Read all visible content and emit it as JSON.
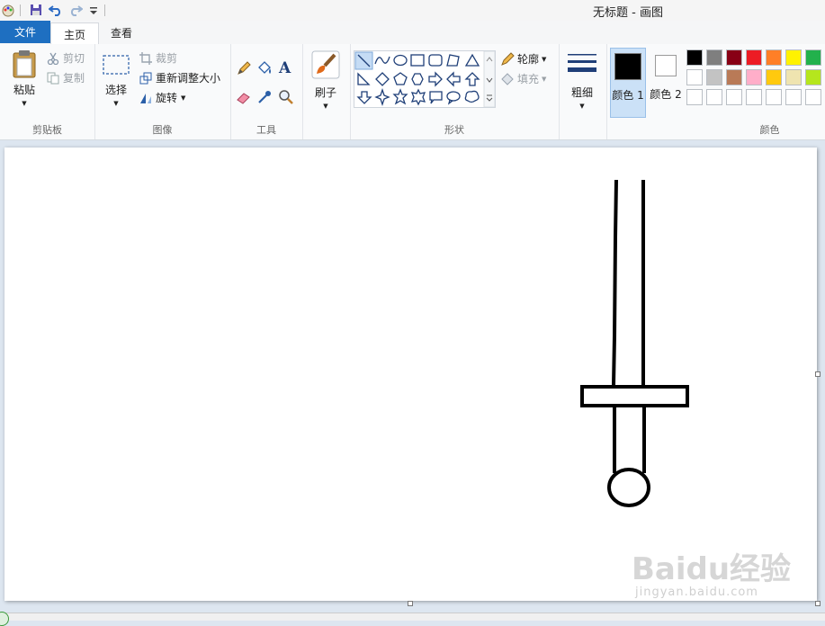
{
  "window": {
    "title": "无标题 - 画图"
  },
  "tabs": {
    "file": "文件",
    "home": "主页",
    "view": "查看"
  },
  "clipboard": {
    "paste": "粘贴",
    "cut": "剪切",
    "copy": "复制",
    "group": "剪贴板"
  },
  "image": {
    "select": "选择",
    "crop": "裁剪",
    "resize": "重新调整大小",
    "rotate": "旋转",
    "group": "图像"
  },
  "tools": {
    "group": "工具"
  },
  "brush": {
    "label": "刷子"
  },
  "shapes": {
    "outline": "轮廓",
    "fill": "填充",
    "group": "形状"
  },
  "size": {
    "label": "粗细"
  },
  "colors": {
    "color1": "颜色 1",
    "color2": "颜色 2",
    "group": "颜色",
    "color1_value": "#000000",
    "color2_value": "#ffffff",
    "palette_row1": [
      "#000000",
      "#7f7f7f",
      "#880015",
      "#ed1c24",
      "#ff7f27",
      "#fff200",
      "#22b14c"
    ],
    "palette_row2": [
      "#ffffff",
      "#c3c3c3",
      "#b97a57",
      "#ffaec9",
      "#ffc90e",
      "#efe4b0",
      "#b5e61d"
    ],
    "palette_row3": [
      "#ffffff",
      "#ffffff",
      "#ffffff",
      "#ffffff",
      "#ffffff",
      "#ffffff",
      "#ffffff"
    ]
  },
  "watermark": {
    "brand": "Baidu经验",
    "url": "jingyan.baidu.com"
  }
}
